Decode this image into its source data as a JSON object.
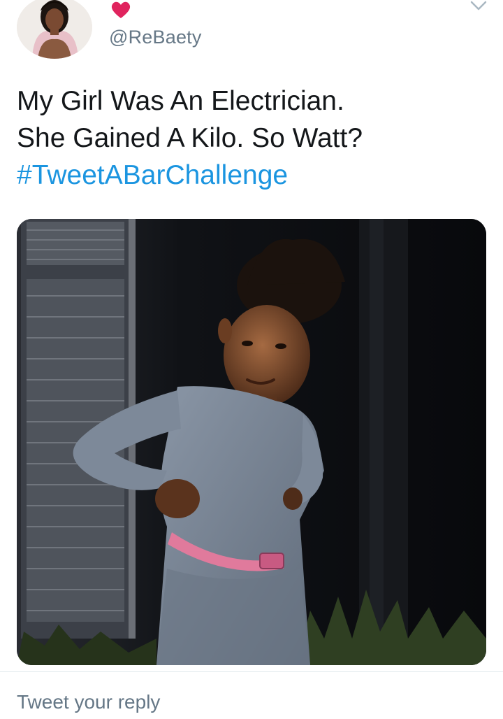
{
  "tweet": {
    "author_handle": "@ReBaety",
    "lines": [
      "My Girl Was An Electrician.",
      "She Gained A Kilo. So Watt?"
    ],
    "hashtag": "#TweetABarChallenge",
    "liked_icon": "heart-icon",
    "menu_icon": "chevron-down-icon"
  },
  "composer": {
    "placeholder": "Tweet your reply"
  },
  "colors": {
    "link": "#1b95e0",
    "heart": "#e0245e",
    "secondary_text": "#657786"
  }
}
